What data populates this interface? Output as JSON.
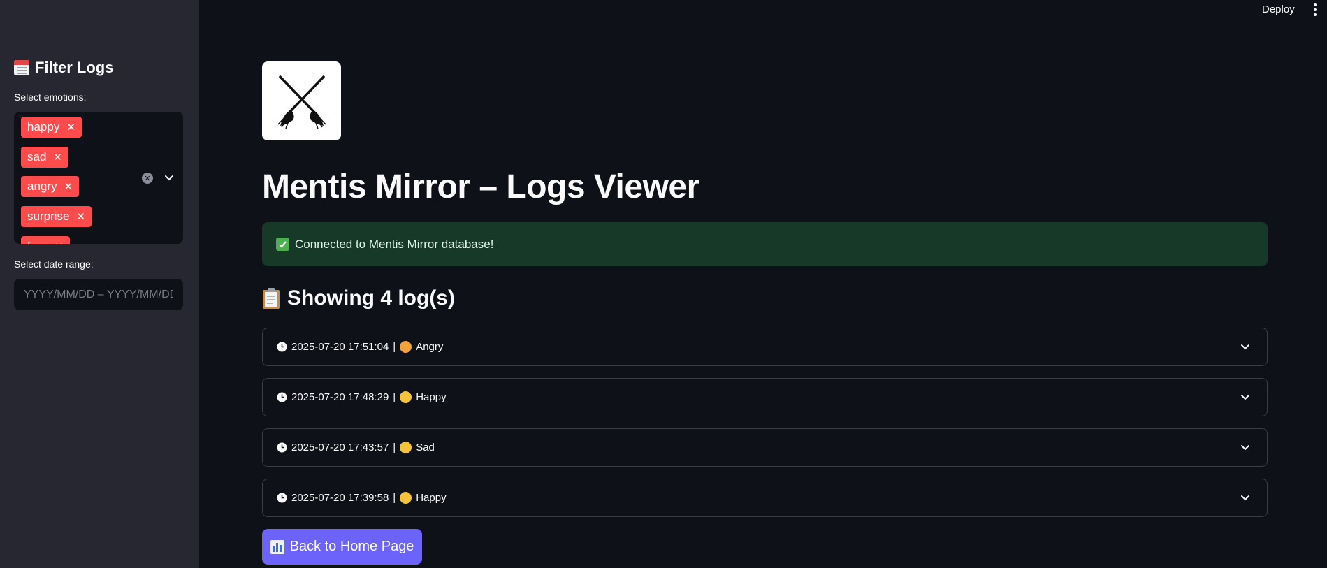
{
  "sidebar": {
    "title": "Filter Logs",
    "emotions_label": "Select emotions:",
    "emotions": [
      "happy",
      "sad",
      "angry",
      "surprise",
      "fear"
    ],
    "date_label": "Select date range:",
    "date_placeholder": "YYYY/MM/DD – YYYY/MM/DD"
  },
  "header": {
    "deploy_label": "Deploy"
  },
  "main": {
    "title": "Mentis Mirror – Logs Viewer",
    "alert": "Connected to Mentis Mirror database!",
    "section_title": "Showing 4 log(s)",
    "logs": [
      {
        "timestamp": "2025-07-20 17:51:04",
        "emotion": "Angry"
      },
      {
        "timestamp": "2025-07-20 17:48:29",
        "emotion": "Happy"
      },
      {
        "timestamp": "2025-07-20 17:43:57",
        "emotion": "Sad"
      },
      {
        "timestamp": "2025-07-20 17:39:58",
        "emotion": "Happy"
      }
    ],
    "separator": "|",
    "home_button": "Back to Home Page"
  },
  "colors": {
    "chip": "#ff4b4b",
    "primary_button": "#6b63fa",
    "success_bg": "#173928",
    "sidebar_bg": "#262730",
    "page_bg": "#0e1117"
  }
}
